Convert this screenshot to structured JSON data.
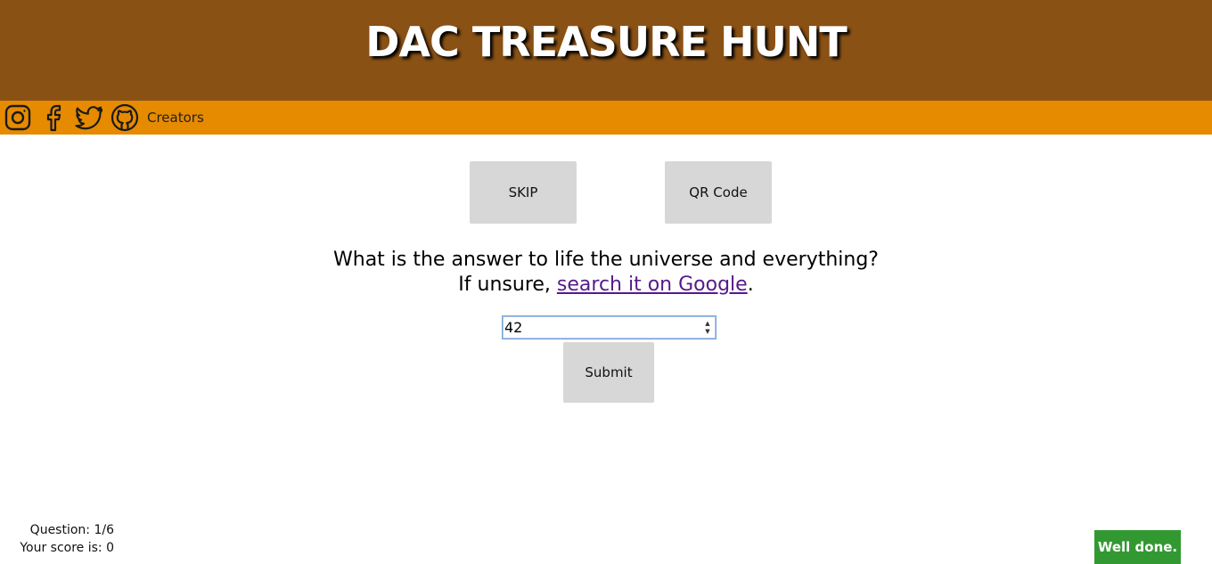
{
  "header": {
    "title": "DAC TREASURE HUNT"
  },
  "nav": {
    "icons": [
      "instagram-icon",
      "facebook-icon",
      "twitter-icon",
      "github-icon"
    ],
    "creators_label": "Creators",
    "icon_color": "#1a1a1a"
  },
  "buttons": {
    "skip": "SKIP",
    "qr": "QR Code",
    "submit": "Submit"
  },
  "question": {
    "line1": "What is the answer to life the universe and everything?",
    "line2_prefix": "If unsure, ",
    "link_text": "search it on Google",
    "line2_suffix": "."
  },
  "answer": {
    "value": "42"
  },
  "stats": {
    "question": "Question: 1/6",
    "score": "Your score is: 0"
  },
  "toast": {
    "message": "Well done."
  },
  "colors": {
    "header_bg": "#8a5115",
    "nav_bg": "#e68a00",
    "toast_bg": "#329932",
    "link": "#551a8b"
  }
}
